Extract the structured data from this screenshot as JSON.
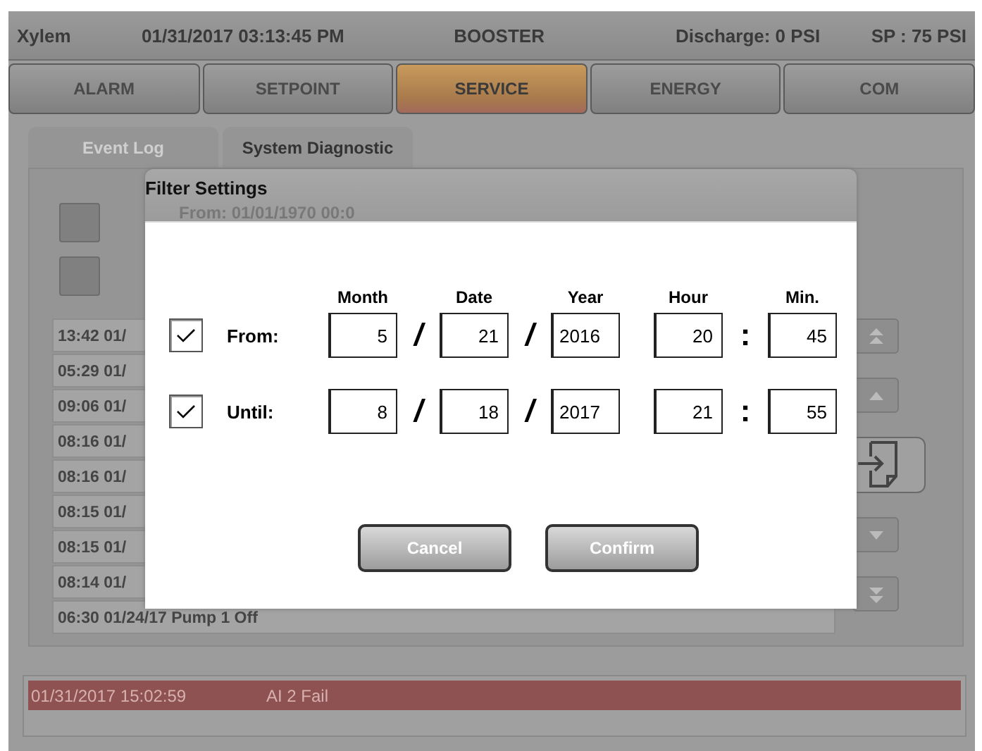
{
  "header": {
    "brand": "Xylem",
    "datetime": "01/31/2017 03:13:45 PM",
    "mode": "BOOSTER",
    "discharge": "Discharge: 0 PSI",
    "setpoint": "SP : 75 PSI"
  },
  "nav_tabs": [
    {
      "label": "ALARM",
      "selected": false
    },
    {
      "label": "SETPOINT",
      "selected": false
    },
    {
      "label": "SERVICE",
      "selected": true
    },
    {
      "label": "ENERGY",
      "selected": false
    },
    {
      "label": "COM",
      "selected": false
    }
  ],
  "sub_tabs": [
    {
      "label": "Event Log",
      "selected": true
    },
    {
      "label": "System Diagnostic",
      "selected": false
    }
  ],
  "event_log": {
    "filter_summary": "From: 01/01/1970 00:0",
    "rows": [
      {
        "text": "13:42 01/"
      },
      {
        "text": "05:29 01/"
      },
      {
        "text": "09:06 01/"
      },
      {
        "text": "08:16 01/"
      },
      {
        "text": "08:16 01/"
      },
      {
        "text": "08:15 01/"
      },
      {
        "text": "08:15 01/"
      },
      {
        "text": "08:14 01/"
      },
      {
        "text": "06:30 01/24/17 Pump 1 Off"
      }
    ]
  },
  "alarm_bar": {
    "time": "01/31/2017 15:02:59",
    "message": "AI 2 Fail"
  },
  "filter_dialog": {
    "title": "Filter Settings",
    "columns": [
      "Month",
      "Date",
      "Year",
      "Hour",
      "Min."
    ],
    "rows": [
      {
        "label": "From:",
        "checked": true,
        "month": "5",
        "date": "21",
        "year": "2016",
        "hour": "20",
        "minute": "45",
        "separators": [
          "/",
          "/",
          ":"
        ]
      },
      {
        "label": "Until:",
        "checked": true,
        "month": "8",
        "date": "18",
        "year": "2017",
        "hour": "21",
        "minute": "55",
        "separators": [
          "/",
          "/",
          ":"
        ]
      }
    ],
    "buttons": [
      {
        "label": "Cancel"
      },
      {
        "label": "Confirm"
      }
    ]
  }
}
